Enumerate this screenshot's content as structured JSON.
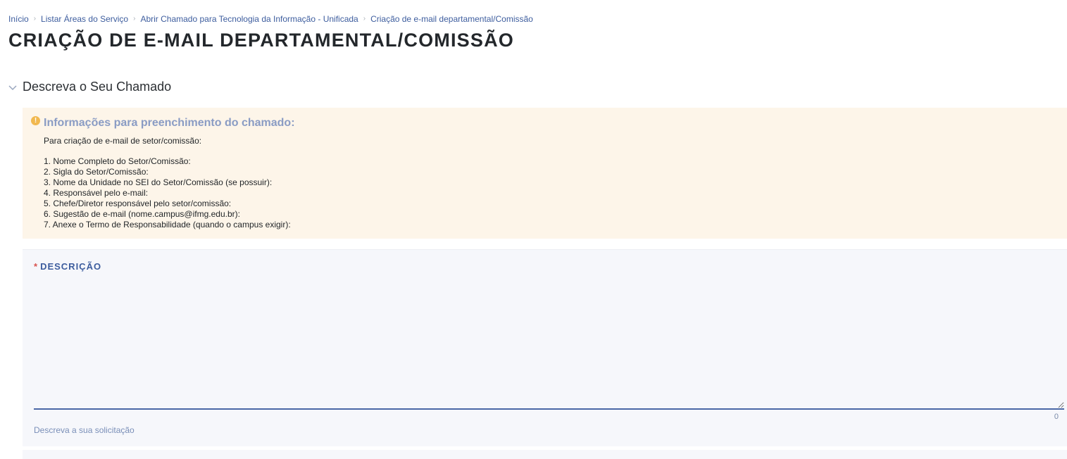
{
  "breadcrumb": [
    "Início",
    "Listar Áreas do Serviço",
    "Abrir Chamado para Tecnologia da Informação - Unificada",
    "Criação de e-mail departamental/Comissão"
  ],
  "page_title": "CRIAÇÃO DE E-MAIL DEPARTAMENTAL/COMISSÃO",
  "section": {
    "title": "Descreva o Seu Chamado",
    "expanded": true
  },
  "info": {
    "icon": "warning-icon",
    "title": "Informações para preenchimento do chamado:",
    "intro": "Para criação de e-mail de setor/comissão:",
    "items": [
      "1. Nome Completo do Setor/Comissão:",
      "2. Sigla do Setor/Comissão:",
      "3. Nome da Unidade no SEI do Setor/Comissão (se possuir):",
      "4. Responsável pelo e-mail:",
      "5. Chefe/Diretor responsável pelo setor/comissão:",
      "6. Sugestão de e-mail (nome.campus@ifmg.edu.br):",
      "7. Anexe o Termo de Responsabilidade (quando o campus exigir):"
    ],
    "background": "#fdf5e9"
  },
  "form": {
    "required_marker": "*",
    "description_label": "DESCRIÇÃO",
    "description_value": "",
    "char_count": "0",
    "help_text": "Descreva a sua solicitação"
  },
  "colors": {
    "accent": "#3d5d9e",
    "warning": "#f1b84f",
    "required": "#d9534f"
  }
}
